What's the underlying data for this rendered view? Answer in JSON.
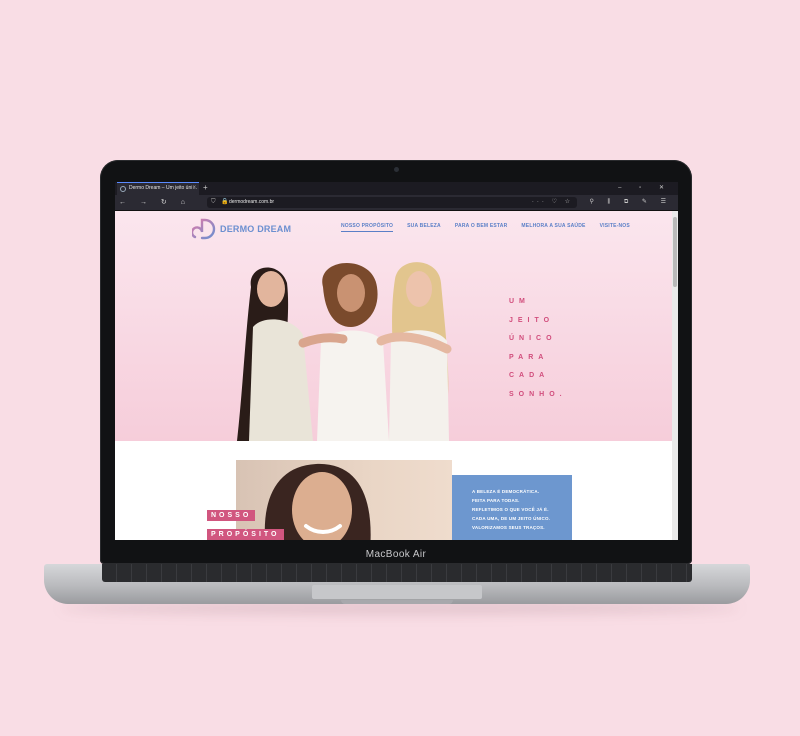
{
  "device": {
    "model_label": "MacBook Air"
  },
  "browser": {
    "tab_title": "Dermo Dream – Um jeito úni…",
    "new_tab": "+",
    "window_controls": "– ▫ ✕",
    "nav_buttons": "← → ↻ ⌂",
    "url": "dermodream.com.br",
    "url_left_icons": "⛉ 🔒",
    "url_right_icons": "··· ♡ ☆",
    "toolbar_right": "⚲ ⫼ ⧉ ✎ ☰"
  },
  "site": {
    "brand": "DERMO DREAM",
    "menu": [
      {
        "label": "NOSSO PROPÓSITO",
        "active": true
      },
      {
        "label": "SUA BELEZA",
        "active": false
      },
      {
        "label": "PARA O BEM ESTAR",
        "active": false
      },
      {
        "label": "MELHORA A SUA SAÚDE",
        "active": false
      },
      {
        "label": "VISITE-NOS",
        "active": false
      }
    ],
    "tagline": [
      "UM",
      "JEITO",
      "ÚNICO",
      "PARA",
      "CADA",
      "SONHO."
    ],
    "purpose_label": [
      "NOSSO",
      "PROPÓSITO"
    ],
    "purpose_text": [
      "A BELEZA É DEMOCRÁTICA.",
      "FEITA PARA TODAS.",
      "REFLETIMOS O QUE VOCÊ JÁ É.",
      "CADA UMA, DE UM JEITO ÚNICO.",
      "VALORIZAMOS SEUS TRAÇOS."
    ],
    "colors": {
      "accent_pink": "#d14d7c",
      "accent_blue": "#6d97cf",
      "hero_bg": "#f6cdda"
    }
  }
}
